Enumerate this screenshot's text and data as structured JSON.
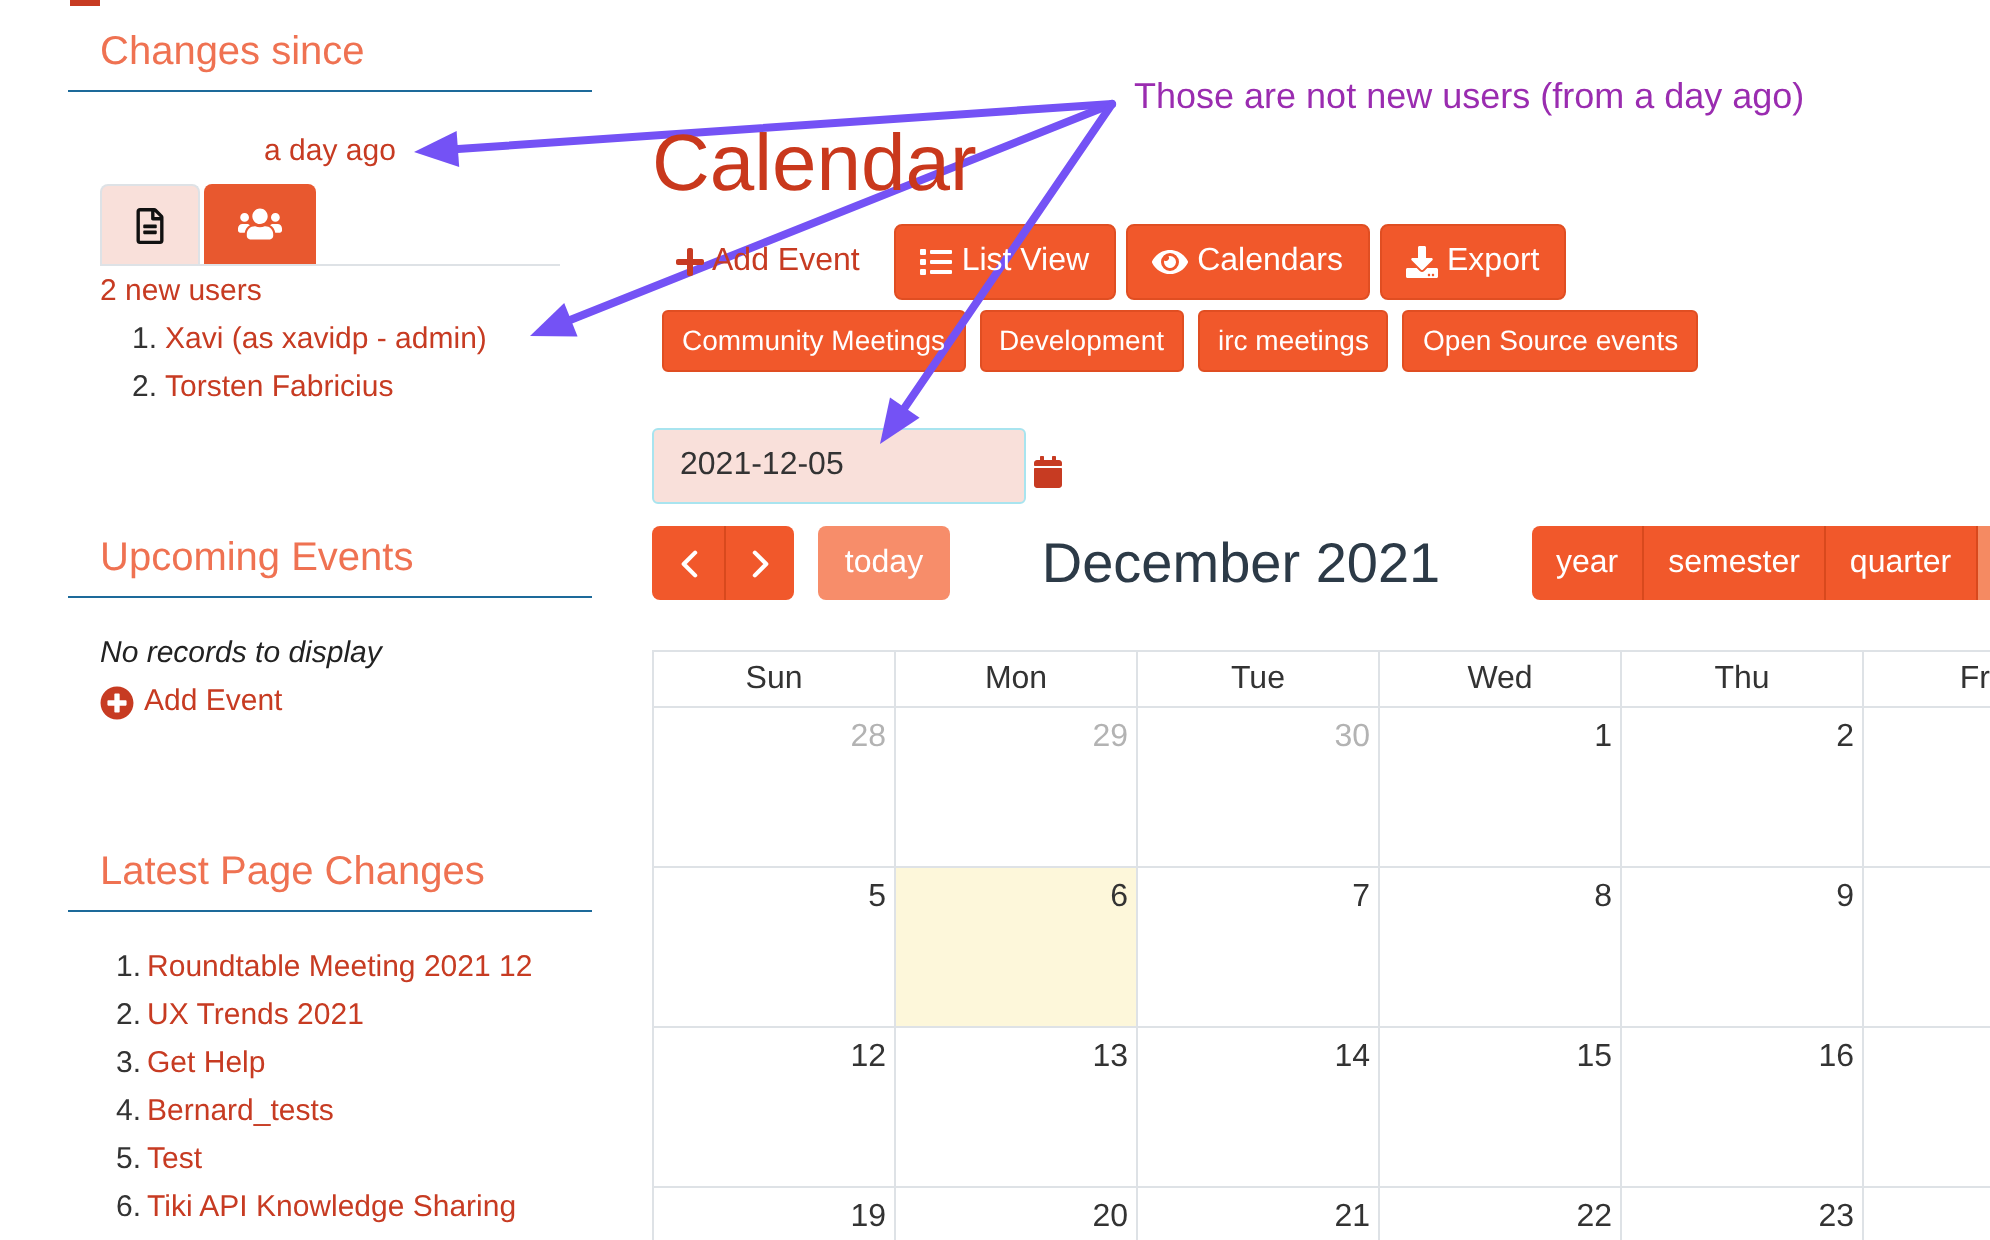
{
  "changes_since": {
    "title": "Changes since",
    "period": "a day ago",
    "tabs": [
      {
        "selected": false
      },
      {
        "selected": true
      }
    ],
    "summary": "2 new users",
    "users": [
      {
        "number": "1.",
        "name": "Xavi (as xavidp - admin)"
      },
      {
        "number": "2.",
        "name": "Torsten Fabricius"
      }
    ]
  },
  "upcoming_events": {
    "title": "Upcoming Events",
    "empty_message": "No records to display",
    "add_link": "Add Event"
  },
  "latest_page_changes": {
    "title": "Latest Page Changes",
    "items": [
      {
        "number": "1.",
        "label": "Roundtable Meeting 2021 12"
      },
      {
        "number": "2.",
        "label": "UX Trends 2021"
      },
      {
        "number": "3.",
        "label": "Get Help"
      },
      {
        "number": "4.",
        "label": "Bernard_tests"
      },
      {
        "number": "5.",
        "label": "Test"
      },
      {
        "number": "6.",
        "label": "Tiki API Knowledge Sharing"
      }
    ]
  },
  "main": {
    "title": "Calendar",
    "add_event": "Add Event",
    "action_buttons": [
      "List View",
      "Calendars",
      "Export"
    ],
    "calendar_filters": [
      "Community Meetings",
      "Development",
      "irc meetings",
      "Open Source events"
    ],
    "date_field": {
      "value": "2021-12-05"
    },
    "today_button": {
      "label": "today",
      "disabled": true
    },
    "month_title": "December 2021",
    "views": [
      {
        "label": "year",
        "selected": false
      },
      {
        "label": "semester",
        "selected": false
      },
      {
        "label": "quarter",
        "selected": false
      },
      {
        "selected": true
      }
    ]
  },
  "calendar": {
    "weekdays": [
      "Sun",
      "Mon",
      "Tue",
      "Wed",
      "Thu",
      "Fr"
    ],
    "weeks": [
      [
        {
          "label": "28",
          "other_month": true,
          "today": false
        },
        {
          "label": "29",
          "other_month": true,
          "today": false
        },
        {
          "label": "30",
          "other_month": true,
          "today": false
        },
        {
          "label": "1",
          "other_month": false,
          "today": false
        },
        {
          "label": "2",
          "other_month": false,
          "today": false
        }
      ],
      [
        {
          "label": "5",
          "other_month": false,
          "today": false
        },
        {
          "label": "6",
          "other_month": false,
          "today": true
        },
        {
          "label": "7",
          "other_month": false,
          "today": false
        },
        {
          "label": "8",
          "other_month": false,
          "today": false
        },
        {
          "label": "9",
          "other_month": false,
          "today": false
        }
      ],
      [
        {
          "label": "12",
          "other_month": false,
          "today": false
        },
        {
          "label": "13",
          "other_month": false,
          "today": false
        },
        {
          "label": "14",
          "other_month": false,
          "today": false
        },
        {
          "label": "15",
          "other_month": false,
          "today": false
        },
        {
          "label": "16",
          "other_month": false,
          "today": false
        }
      ],
      [
        {
          "label": "19",
          "other_month": false,
          "today": false
        },
        {
          "label": "20",
          "other_month": false,
          "today": false
        },
        {
          "label": "21",
          "other_month": false,
          "today": false
        },
        {
          "label": "22",
          "other_month": false,
          "today": false
        },
        {
          "label": "23",
          "other_month": false,
          "today": false
        }
      ]
    ]
  },
  "annotation": {
    "text": "Those are not new users (from a day ago)"
  }
}
